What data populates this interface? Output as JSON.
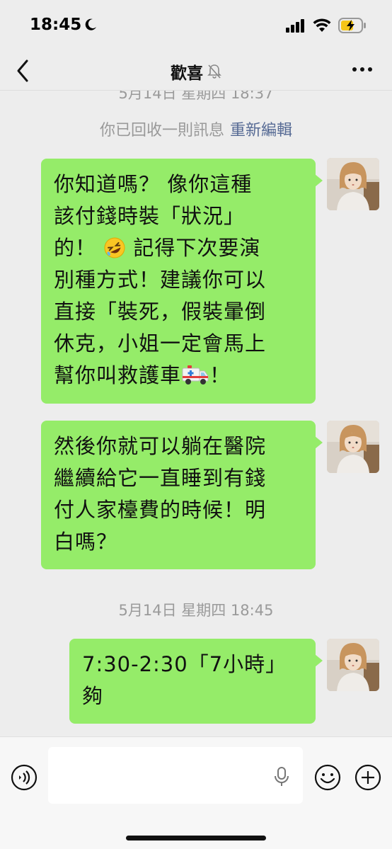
{
  "status_bar": {
    "time": "18:45"
  },
  "header": {
    "title": "歡喜"
  },
  "messages": {
    "partial_timestamp": "5月14日 星期四 18:37",
    "recall_note": "你已回收一則訊息",
    "reedit_link": "重新編輯",
    "bubble1": {
      "line1": "你知道嗎？ 像你這種",
      "line2": "該付錢時裝「狀況」",
      "line3a": "的！ ",
      "line3b": " 記得下次要演",
      "line4": "別種方式！建議你可以",
      "line5": "直接「裝死，假裝暈倒",
      "line6": "休克，小姐一定會馬上",
      "line7a": "幫你叫救護車",
      "line7b": "！"
    },
    "bubble2": {
      "line1": "然後你就可以躺在醫院",
      "line2": "繼續給它一直睡到有錢",
      "line3": "付人家檯費的時候！明",
      "line4": "白嗎？"
    },
    "timestamp2": "5月14日 星期四 18:45",
    "bubble3": {
      "line1": "7:30-2:30「7小時」",
      "line2": "夠"
    }
  },
  "icons": {
    "moon": "moon-icon",
    "signal": "signal-icon",
    "wifi": "wifi-icon",
    "battery": "battery-charging-icon",
    "back": "chevron-left-icon",
    "mute": "bell-slash-icon",
    "more": "more-dots-icon",
    "voice": "voice-icon",
    "mic": "mic-icon",
    "emoji": "emoji-icon",
    "plus": "plus-icon"
  },
  "colors": {
    "bubble": "#95ec69",
    "link": "#576b95",
    "background": "#ededed"
  }
}
